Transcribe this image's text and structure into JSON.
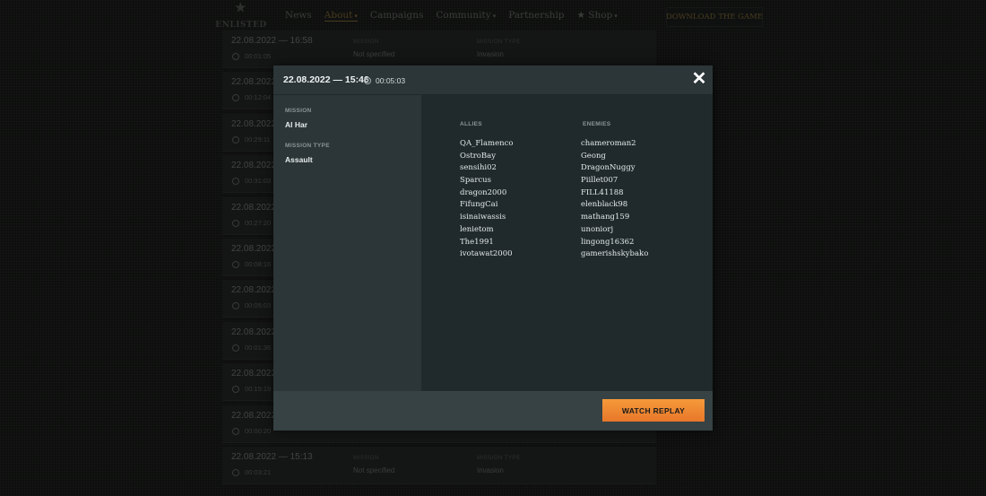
{
  "header": {
    "logo_text": "ENLISTED",
    "nav": [
      {
        "label": "News",
        "caret": ""
      },
      {
        "label": "About",
        "caret": "▾"
      },
      {
        "label": "Campaigns",
        "caret": ""
      },
      {
        "label": "Community",
        "caret": "▾"
      },
      {
        "label": "Partnership",
        "caret": ""
      },
      {
        "label": "★ Shop",
        "caret": "▾"
      }
    ],
    "download_label": "DOWNLOAD THE GAME"
  },
  "replays": {
    "mission_label": "MISSION",
    "mission_type_label": "MISSION TYPE",
    "rows": [
      {
        "date": "22.08.2022 — 16:58",
        "duration": "00:01:05",
        "mission": "Not specified",
        "mission_type": "Invasion"
      },
      {
        "date": "22.08.2022",
        "duration": "00:12:04",
        "mission": "",
        "mission_type": ""
      },
      {
        "date": "22.08.2022",
        "duration": "00:29:11",
        "mission": "",
        "mission_type": ""
      },
      {
        "date": "22.08.2022",
        "duration": "00:31:03",
        "mission": "",
        "mission_type": ""
      },
      {
        "date": "22.08.2022",
        "duration": "00:27:20",
        "mission": "",
        "mission_type": ""
      },
      {
        "date": "22.08.2022",
        "duration": "00:08:16",
        "mission": "",
        "mission_type": ""
      },
      {
        "date": "22.08.2022",
        "duration": "00:05:03",
        "mission": "",
        "mission_type": ""
      },
      {
        "date": "22.08.2022",
        "duration": "00:01:36",
        "mission": "",
        "mission_type": ""
      },
      {
        "date": "22.08.2022",
        "duration": "00:15:19",
        "mission": "",
        "mission_type": ""
      },
      {
        "date": "22.08.2022",
        "duration": "00:00:20",
        "mission": "",
        "mission_type": ""
      },
      {
        "date": "22.08.2022 — 15:13",
        "duration": "00:03:21",
        "mission": "Not specified",
        "mission_type": "Invasion"
      }
    ]
  },
  "modal": {
    "date_time": "22.08.2022 — 15:46",
    "duration": "00:05:03",
    "close_symbol": "✕",
    "mission_label": "MISSION",
    "mission_value": "Al Har",
    "mission_type_label": "MISSION TYPE",
    "mission_type_value": "Assault",
    "allies_label": "ALLIES",
    "enemies_label": "ENEMIES",
    "allies": [
      "QA_Flamenco",
      "OstroBay",
      "sensihi02",
      "Sparcus",
      "dragon2000",
      "FifungCai",
      "isinaiwassis",
      "lenietom",
      "The1991",
      "ivotawat2000"
    ],
    "enemies": [
      "chameroman2",
      "Geong",
      "DragonNuggy",
      "Piillet007",
      "FILL41188",
      "elenblack98",
      "mathang159",
      "unoniorj",
      "lingong16362",
      "gamerishskybako"
    ],
    "watch_replay_label": "WATCH REPLAY"
  },
  "colors": {
    "accent_orange": "#f0893a",
    "modal_bg": "#2c3638",
    "modal_right_bg": "#202a2c",
    "page_bg": "#121312"
  }
}
